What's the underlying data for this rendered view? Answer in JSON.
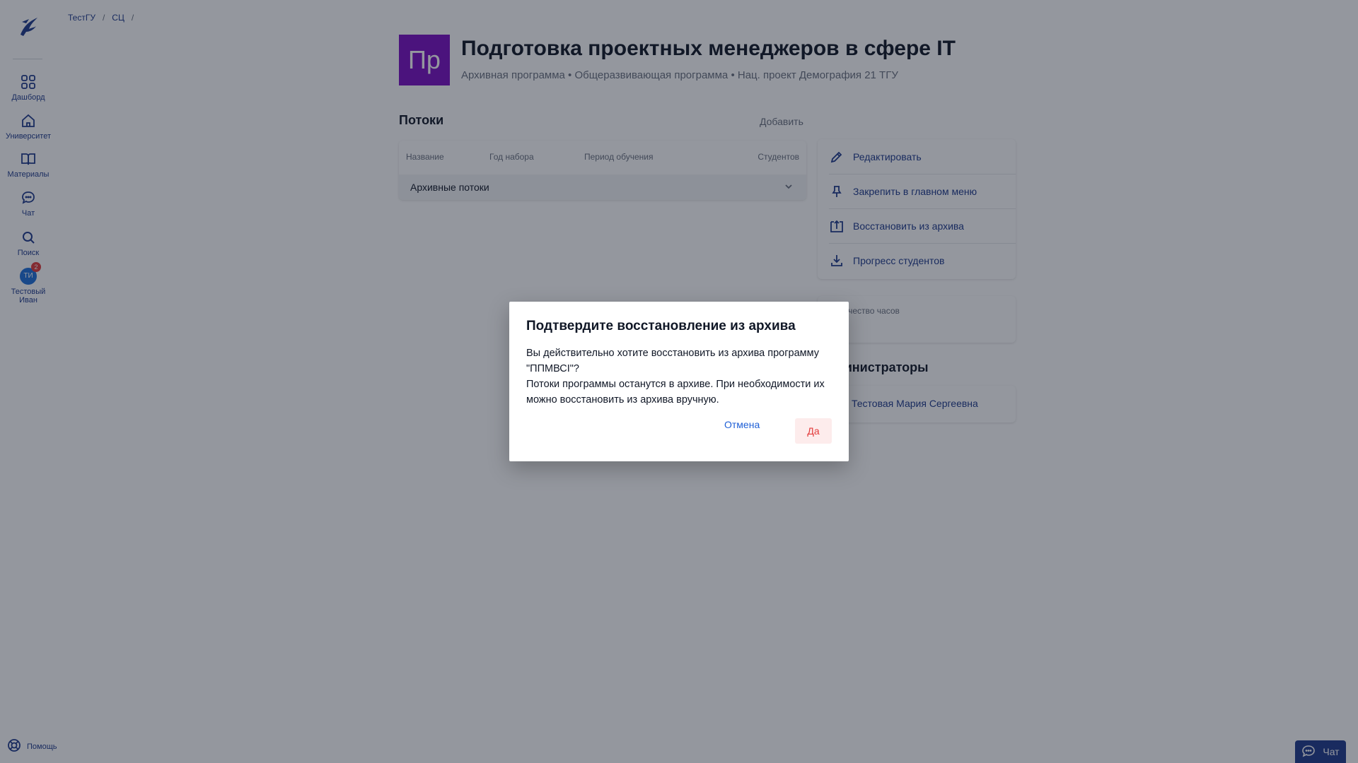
{
  "sidebar": {
    "items": [
      {
        "label": "Дашборд",
        "icon": "grid-icon"
      },
      {
        "label": "Университет",
        "icon": "home-icon"
      },
      {
        "label": "Материалы",
        "icon": "book-icon"
      },
      {
        "label": "Чат",
        "icon": "chat-icon"
      },
      {
        "label": "Поиск",
        "icon": "search-icon"
      }
    ],
    "profile": {
      "initials": "ТИ",
      "badge": "2",
      "name_line1": "Тестовый",
      "name_line2": "Иван"
    },
    "help_label": "Помощь"
  },
  "breadcrumbs": {
    "item1": "ТестГУ",
    "item2": "СЦ",
    "sep": "/"
  },
  "program": {
    "avatar_text": "Пр",
    "avatar_color": "#7a0fc4",
    "title": "Подготовка проектных менеджеров в сфере IT",
    "subtitle": "Архивная программа • Общеразвивающая программа • Нац. проект Демография 21 ТГУ"
  },
  "streams": {
    "title": "Потоки",
    "add_label": "Добавить",
    "columns": [
      "Название",
      "Год набора",
      "Период обучения",
      "Студентов"
    ],
    "archived_label": "Архивные потоки"
  },
  "actions": [
    {
      "label": "Редактировать",
      "icon": "pencil-icon"
    },
    {
      "label": "Закрепить в главном меню",
      "icon": "pin-icon"
    },
    {
      "label": "Восстановить из архива",
      "icon": "unarchive-icon"
    },
    {
      "label": "Прогресс студентов",
      "icon": "download-icon"
    }
  ],
  "hours_label": "Количество часов",
  "admins": {
    "title": "Администраторы",
    "name": "Тестовая Мария Сергеевна"
  },
  "chat_button": "Чат",
  "modal": {
    "title": "Подтвердите восстановление из архива",
    "body_line1": "Вы действительно хотите восстановить из архива программу \"ППМВСI\"?",
    "body_line2": "Потоки программы останутся в архиве. При необходимости их можно восстановить из архива вручную.",
    "cancel": "Отмена",
    "confirm": "Да"
  },
  "colors": {
    "accent": "#1f3b8c",
    "danger": "#e23b3b",
    "overlay": "rgba(17,24,39,0.45)"
  }
}
